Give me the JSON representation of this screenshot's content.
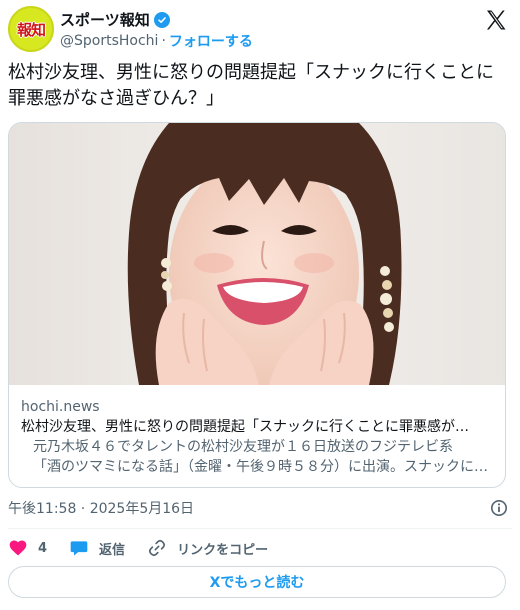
{
  "account": {
    "avatar_text": "報知",
    "display_name": "スポーツ報知",
    "handle": "@SportsHochi",
    "separator": "·",
    "follow_label": "フォローする"
  },
  "tweet": {
    "text": "松村沙友理、男性に怒りの問題提起「スナックに行くことに罪悪感がなさ過ぎひん？」"
  },
  "link_card": {
    "domain": "hochi.news",
    "title": "松村沙友理、男性に怒りの問題提起「スナックに行くことに罪悪感が…",
    "description_line1": "元乃木坂４６でタレントの松村沙友理が１６日放送のフジテレビ系",
    "description_line2": "「酒のツマミになる話」（金曜・午後９時５８分）に出演。スナックに…"
  },
  "timestamp": "午後11:58 · 2025年5月16日",
  "actions": {
    "like_count": "4",
    "reply_label": "返信",
    "copy_link_label": "リンクをコピー"
  },
  "read_more_label": "Xでもっと読む",
  "colors": {
    "accent": "#1d9bf0",
    "like": "#f91880",
    "secondary_text": "#536471",
    "avatar_bg": "#d8e820",
    "avatar_text": "#d0161b"
  },
  "icons": [
    "verified-badge-icon",
    "x-logo-icon",
    "info-icon",
    "heart-icon",
    "reply-icon",
    "link-icon"
  ]
}
